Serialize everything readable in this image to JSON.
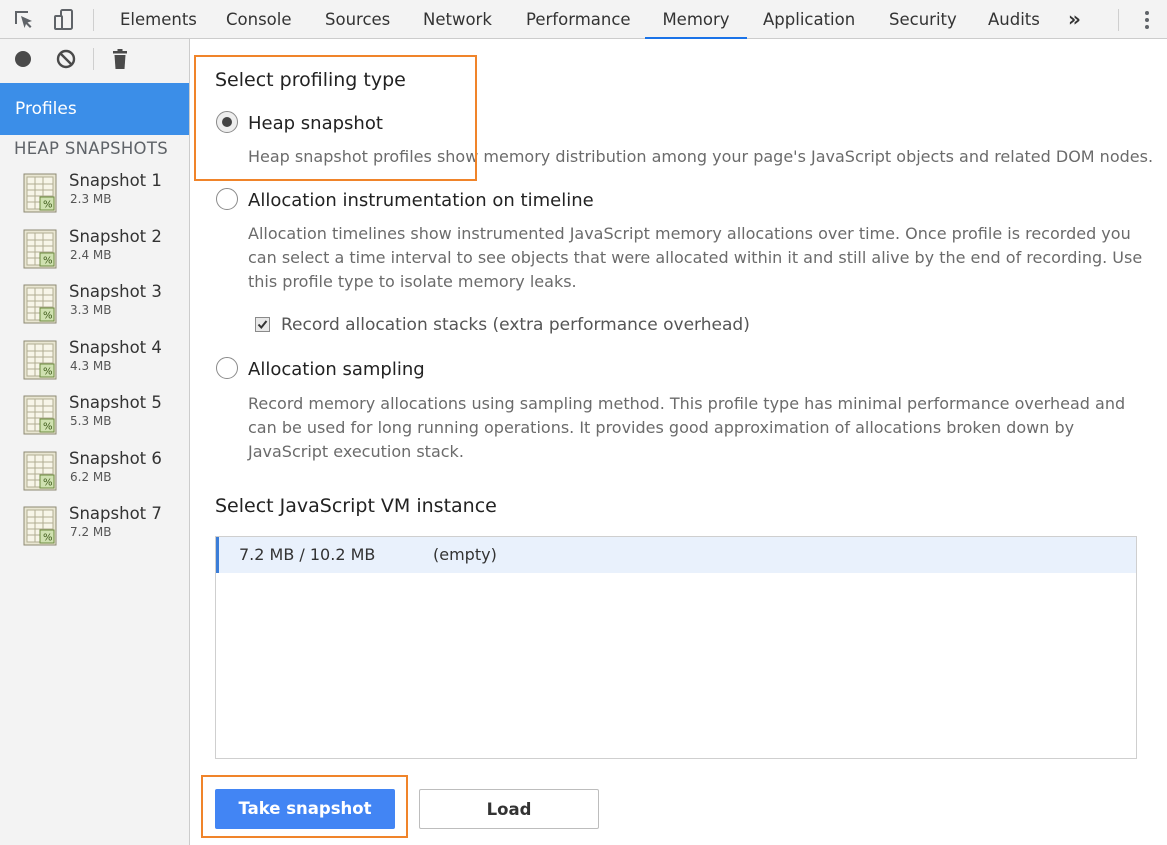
{
  "tabs": [
    "Elements",
    "Console",
    "Sources",
    "Network",
    "Performance",
    "Memory",
    "Application",
    "Security",
    "Audits"
  ],
  "active_tab": "Memory",
  "more_tabs_glyph": "»",
  "sidebar": {
    "section_title": "Profiles",
    "group_label": "HEAP SNAPSHOTS",
    "snapshots": [
      {
        "title": "Snapshot 1",
        "size": "2.3 MB"
      },
      {
        "title": "Snapshot 2",
        "size": "2.4 MB"
      },
      {
        "title": "Snapshot 3",
        "size": "3.3 MB"
      },
      {
        "title": "Snapshot 4",
        "size": "4.3 MB"
      },
      {
        "title": "Snapshot 5",
        "size": "5.3 MB"
      },
      {
        "title": "Snapshot 6",
        "size": "6.2 MB"
      },
      {
        "title": "Snapshot 7",
        "size": "7.2 MB"
      }
    ]
  },
  "main": {
    "profiling_title": "Select profiling type",
    "options": [
      {
        "label": "Heap snapshot",
        "checked": true,
        "desc": "Heap snapshot profiles show memory distribution among your page's JavaScript objects and related DOM nodes."
      },
      {
        "label": "Allocation instrumentation on timeline",
        "checked": false,
        "desc": "Allocation timelines show instrumented JavaScript memory allocations over time. Once profile is recorded you can select a time interval to see objects that were allocated within it and still alive by the end of recording. Use this profile type to isolate memory leaks."
      },
      {
        "label": "Allocation sampling",
        "checked": false,
        "desc": "Record memory allocations using sampling method. This profile type has minimal performance overhead and can be used for long running operations. It provides good approximation of allocations broken down by JavaScript execution stack."
      }
    ],
    "record_stacks_label": "Record allocation stacks (extra performance overhead)",
    "record_stacks_checked": true,
    "vm_title": "Select JavaScript VM instance",
    "vm_instances": [
      {
        "memory": "7.2 MB / 10.2 MB",
        "name": "(empty)"
      }
    ],
    "take_snapshot_label": "Take snapshot",
    "load_label": "Load"
  },
  "colors": {
    "accent": "#1a73e8",
    "profiles_header": "#3b8ee8",
    "button_primary": "#4285f4",
    "highlight": "#f0842a"
  },
  "icons": [
    "inspect-element-icon",
    "device-toolbar-icon",
    "record-icon",
    "clear-icon",
    "trash-icon",
    "more-tabs-icon",
    "kebab-menu-icon",
    "snapshot-file-icon"
  ]
}
